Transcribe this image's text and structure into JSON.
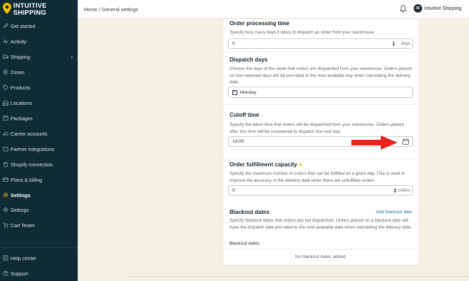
{
  "app": {
    "logo_line1": "INTUITIVE",
    "logo_line2": "SHIPPING",
    "brand_color": "#f2c200"
  },
  "sidebar": {
    "items": [
      {
        "label": "Get started",
        "icon": "rocket-icon"
      },
      {
        "label": "Activity",
        "icon": "activity-icon"
      },
      {
        "label": "Shipping",
        "icon": "truck-icon",
        "has_submenu": true
      },
      {
        "label": "Zones",
        "icon": "zones-icon"
      },
      {
        "label": "Products",
        "icon": "tag-icon"
      },
      {
        "label": "Locations",
        "icon": "warehouse-icon"
      },
      {
        "label": "Packages",
        "icon": "package-icon"
      },
      {
        "label": "Carrier accounts",
        "icon": "carrier-icon"
      },
      {
        "label": "Partner integrations",
        "icon": "puzzle-icon"
      },
      {
        "label": "Shopify connection",
        "icon": "shopify-icon"
      },
      {
        "label": "Plans & billing",
        "icon": "billing-icon"
      },
      {
        "label": "Settings",
        "icon": "gear-icon",
        "active": true
      },
      {
        "label": "Settings",
        "icon": "gear-icon"
      },
      {
        "label": "Cart Tester",
        "icon": "cart-icon"
      }
    ],
    "footer": [
      {
        "label": "Help center",
        "icon": "help-icon"
      },
      {
        "label": "Support",
        "icon": "support-icon"
      }
    ]
  },
  "topbar": {
    "breadcrumb": "Home / General settings",
    "avatar_initials": "IS",
    "user_name": "Intuitive Shipping"
  },
  "sections": {
    "processing": {
      "title": "Order processing time",
      "desc": "Specify how many days it takes to dispatch an order from your warehouse.",
      "value": "0",
      "suffix": "days"
    },
    "dispatch": {
      "title": "Dispatch days",
      "desc": "Choose the days of the week that orders are dispatched from your warehouse. Orders placed on non-selected days will be pro-rated to the next available day when calculating the delivery date.",
      "days": [
        {
          "label": "Monday",
          "checked": true
        }
      ]
    },
    "cutoff": {
      "title": "Cutoff time",
      "desc": "Specify the latest time that orders will be dispatched from your warehouse. Orders placed after this time will be considered to dispatch the next day.",
      "value": "14:00"
    },
    "capacity": {
      "title": "Order fulfillment capacity",
      "desc": "Specify the maximum number of orders that can be fulfilled on a given day. This is used to improve the accuracy of the delivery date when there are unfulfilled orders.",
      "value": "0",
      "suffix": "orders"
    },
    "blackout": {
      "title": "Blackout dates",
      "add_label": "Add blackout date",
      "desc": "Specify blackout dates that orders are not dispatched. Orders placed on a blackout date will have the dispatch date pro-rated to the next available date when calculating the delivery date.",
      "subheading": "Blackout dates",
      "empty": "No blackout dates added."
    }
  },
  "annotation": {
    "arrow_color": "#e8231c"
  }
}
